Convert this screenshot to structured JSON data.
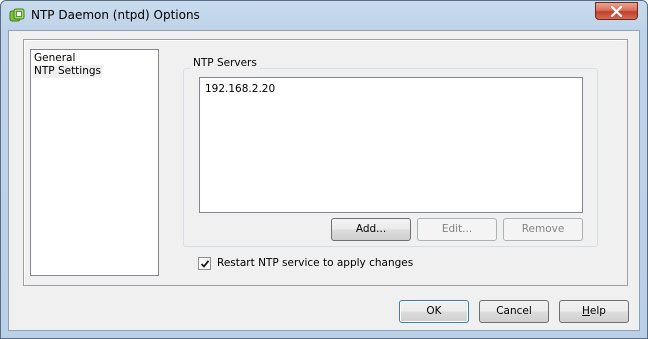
{
  "window": {
    "title": "NTP Daemon (ntpd) Options",
    "icon": "ntp-daemon-app-icon",
    "close_icon": "close-x-icon"
  },
  "nav": {
    "items": [
      {
        "label": "General",
        "selected": false
      },
      {
        "label": "NTP Settings",
        "selected": true
      }
    ]
  },
  "ntp_servers": {
    "group_label": "NTP Servers",
    "servers": [
      "192.168.2.20"
    ],
    "add_label": "Add...",
    "edit_label": "Edit...",
    "edit_enabled": false,
    "remove_label": "Remove",
    "remove_enabled": false
  },
  "restart": {
    "label": "Restart NTP service to apply changes",
    "checked": true
  },
  "footer": {
    "ok_label": "OK",
    "cancel_label": "Cancel",
    "help_label": "Help",
    "help_mnemonic": "H",
    "help_rest": "elp"
  },
  "colors": {
    "title_gradient_top": "#c9dcee",
    "close_button_red": "#c2412b",
    "panel_background": "#f0f0f0",
    "default_button_border": "#3c7fb1"
  }
}
